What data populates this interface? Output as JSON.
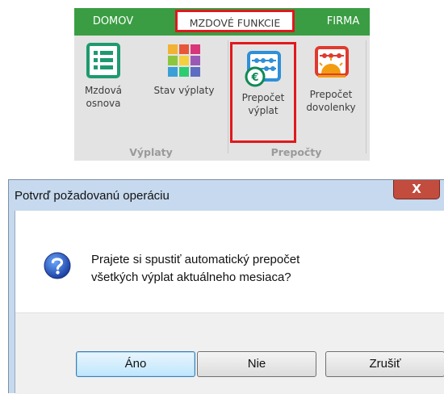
{
  "ribbon": {
    "tabs": [
      {
        "label": "DOMOV"
      },
      {
        "label": "MZDOVÉ FUNKCIE",
        "highlighted": true
      },
      {
        "label": "FIRMA"
      }
    ],
    "buttons": [
      {
        "label_line1": "Mzdová",
        "label_line2": "osnova",
        "icon": "list-icon"
      },
      {
        "label_line1": "Stav výplaty",
        "label_line2": "",
        "icon": "colored-tiles-icon"
      },
      {
        "label_line1": "Prepočet",
        "label_line2": "výplat",
        "icon": "abacus-euro-icon",
        "highlighted": true
      },
      {
        "label_line1": "Prepočet",
        "label_line2": "dovolenky",
        "icon": "abacus-sun-icon"
      }
    ],
    "groups": [
      {
        "label": "Výplaty"
      },
      {
        "label": "Prepočty"
      }
    ],
    "colors": {
      "tab_bar": "#3a9d43",
      "highlight": "#e0191d"
    }
  },
  "dialog": {
    "title": "Potvrď požadovanú operáciu",
    "close_label": "X",
    "icon": "question-icon",
    "message_line1": "Prajete si spustiť automatický prepočet",
    "message_line2": "všetkých výplat aktuálneho mesiaca?",
    "buttons": {
      "yes": "Áno",
      "no": "Nie",
      "cancel": "Zrušiť"
    }
  }
}
